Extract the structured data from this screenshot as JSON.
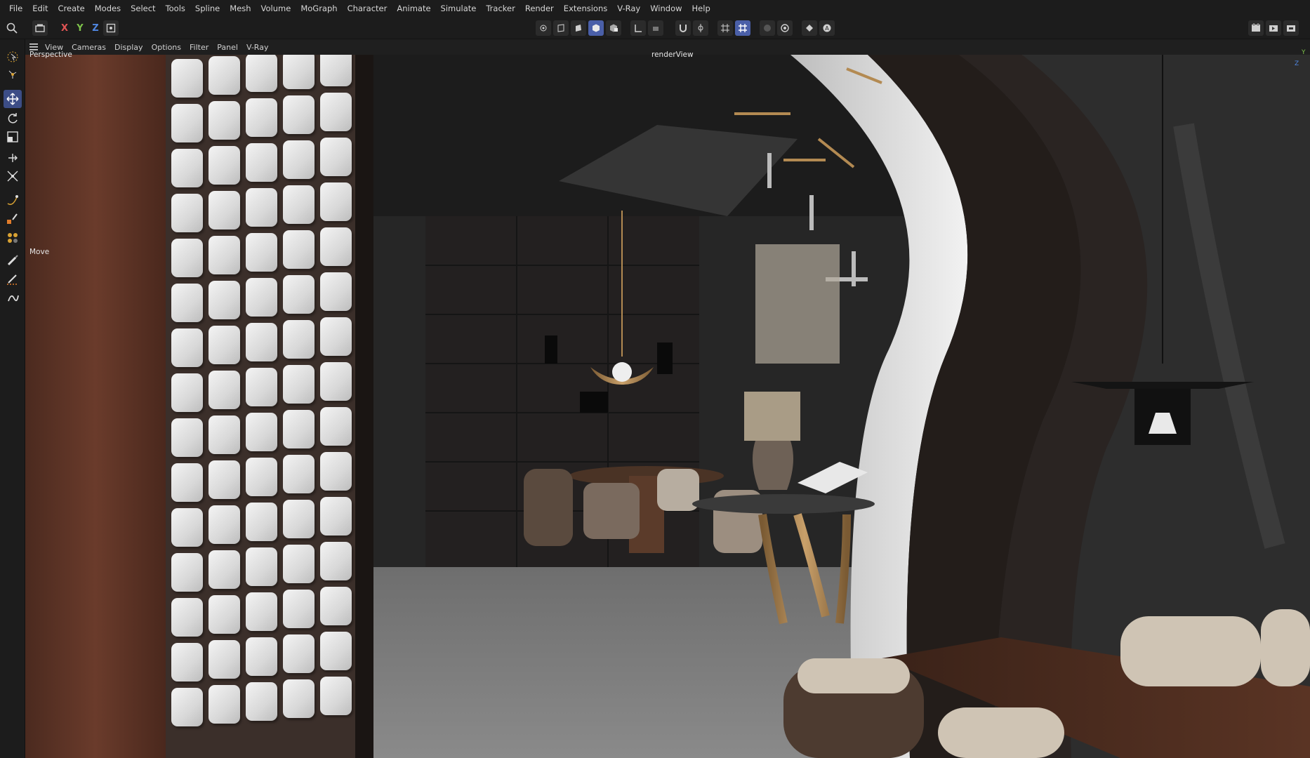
{
  "menu": [
    "File",
    "Edit",
    "Create",
    "Modes",
    "Select",
    "Tools",
    "Spline",
    "Mesh",
    "Volume",
    "MoGraph",
    "Character",
    "Animate",
    "Simulate",
    "Tracker",
    "Render",
    "Extensions",
    "V-Ray",
    "Window",
    "Help"
  ],
  "toolbar": {
    "axes": [
      "X",
      "Y",
      "Z"
    ],
    "axis_colors": [
      "#e05454",
      "#7dc24a",
      "#4f86e0"
    ],
    "accent": "#4a5fa8"
  },
  "viewport": {
    "menu": [
      "View",
      "Cameras",
      "Display",
      "Options",
      "Filter",
      "Panel",
      "V-Ray"
    ],
    "camera_label": "Perspective",
    "render_label": "renderView",
    "tool_label": "Move",
    "axis_gizmo": [
      "Y",
      "Z"
    ]
  },
  "icons": {
    "search": "search-icon",
    "hamburger": "menu-icon"
  }
}
